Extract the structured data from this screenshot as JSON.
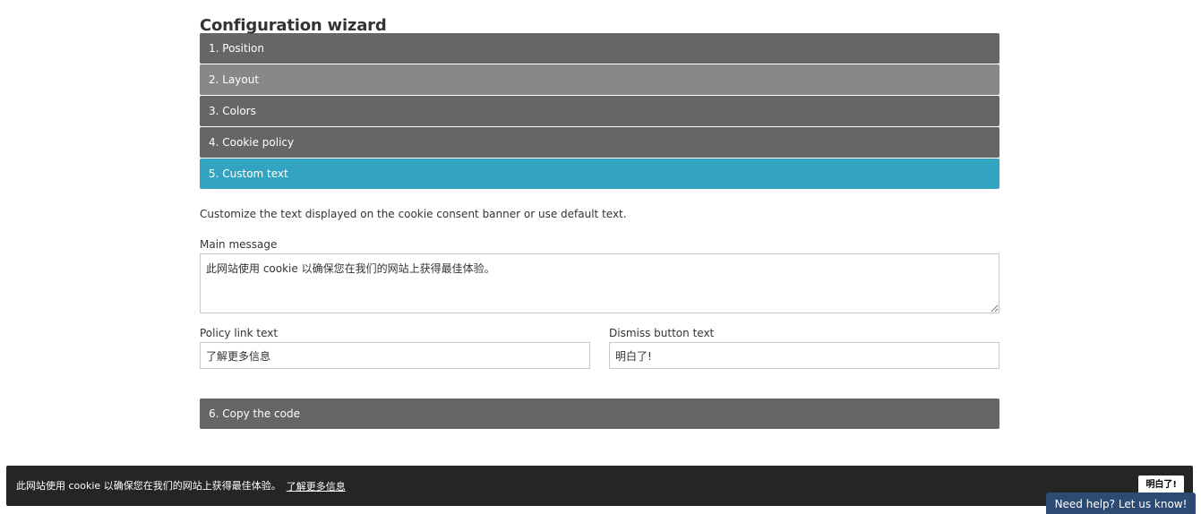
{
  "wizard": {
    "title": "Configuration wizard",
    "steps": [
      {
        "label": "1. Position"
      },
      {
        "label": "2. Layout"
      },
      {
        "label": "3. Colors"
      },
      {
        "label": "4. Cookie policy"
      },
      {
        "label": "5. Custom text"
      },
      {
        "label": "6. Copy the code"
      }
    ],
    "active_step": 5,
    "custom_text": {
      "description": "Customize the text displayed on the cookie consent banner or use default text.",
      "main_message_label": "Main message",
      "main_message_value": "此网站使用 cookie 以确保您在我们的网站上获得最佳体验。",
      "policy_link_label": "Policy link text",
      "policy_link_value": "了解更多信息",
      "dismiss_button_label": "Dismiss button text",
      "dismiss_button_value": "明白了!"
    }
  },
  "cookie_banner": {
    "message": "此网站使用 cookie 以确保您在我们的网站上获得最佳体验。",
    "link_text": "了解更多信息",
    "button_label": "明白了!"
  },
  "help": {
    "label": "Need help? Let us know!"
  },
  "colors": {
    "step_dark": "#666666",
    "step_light": "#878787",
    "step_active": "#33a3c2",
    "banner_bg": "#252525",
    "help_bg": "#2c4a72"
  }
}
